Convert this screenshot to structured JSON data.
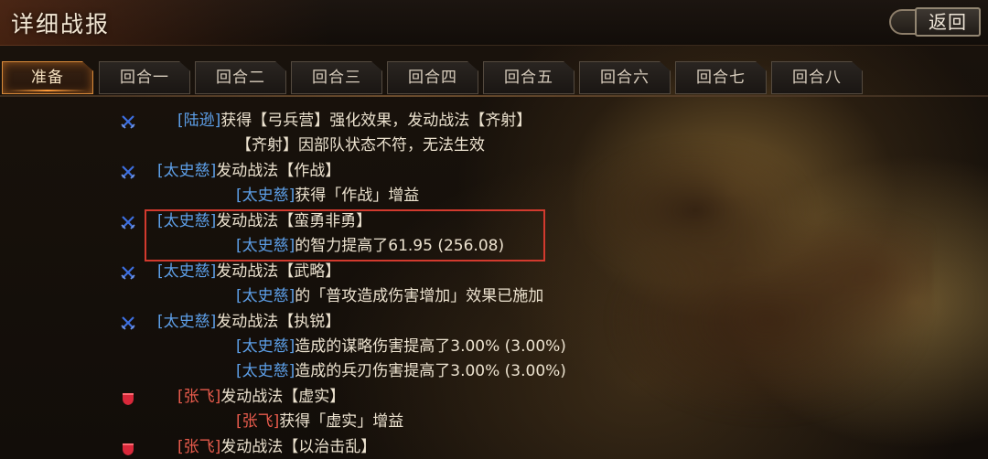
{
  "header": {
    "title": "详细战报",
    "back_label": "返回"
  },
  "tabs": [
    "准备",
    "回合一",
    "回合二",
    "回合三",
    "回合四",
    "回合五",
    "回合六",
    "回合七",
    "回合八"
  ],
  "active_tab": 0,
  "colors": {
    "ally_name": "#5d9fe8",
    "enemy_name": "#e85b4c",
    "highlight_border": "#d23a2e",
    "active_tab_glow": "#ff9c3a"
  },
  "log": [
    {
      "icon": "crossed-swords-icon",
      "name": "[陆逊]",
      "side": "ally",
      "text": "获得【弓兵营】强化效果，发动战法【齐射】"
    },
    {
      "icon": "",
      "name": "",
      "side": "",
      "text": "【齐射】因部队状态不符，无法生效"
    },
    {
      "icon": "crossed-swords-icon",
      "name": "[太史慈]",
      "side": "ally",
      "text": "发动战法【作战】"
    },
    {
      "icon": "",
      "name": "[太史慈]",
      "side": "ally",
      "text": "获得「作战」增益"
    },
    {
      "icon": "crossed-swords-icon",
      "name": "[太史慈]",
      "side": "ally",
      "text": "发动战法【蛮勇非勇】"
    },
    {
      "icon": "",
      "name": "[太史慈]",
      "side": "ally",
      "text": "的智力提高了61.95 (256.08)"
    },
    {
      "icon": "crossed-swords-icon",
      "name": "[太史慈]",
      "side": "ally",
      "text": "发动战法【武略】"
    },
    {
      "icon": "",
      "name": "[太史慈]",
      "side": "ally",
      "text": "的「普攻造成伤害增加」效果已施加"
    },
    {
      "icon": "crossed-swords-icon",
      "name": "[太史慈]",
      "side": "ally",
      "text": "发动战法【执锐】"
    },
    {
      "icon": "",
      "name": "[太史慈]",
      "side": "ally",
      "text": "造成的谋略伤害提高了3.00% (3.00%)"
    },
    {
      "icon": "",
      "name": "[太史慈]",
      "side": "ally",
      "text": "造成的兵刃伤害提高了3.00% (3.00%)"
    },
    {
      "icon": "shield-icon",
      "name": "[张飞]",
      "side": "enemy",
      "text": "发动战法【虚实】"
    },
    {
      "icon": "",
      "name": "[张飞]",
      "side": "enemy",
      "text": "获得「虚实」增益"
    },
    {
      "icon": "shield-icon",
      "name": "[张飞]",
      "side": "enemy",
      "text": "发动战法【以治击乱】"
    }
  ]
}
